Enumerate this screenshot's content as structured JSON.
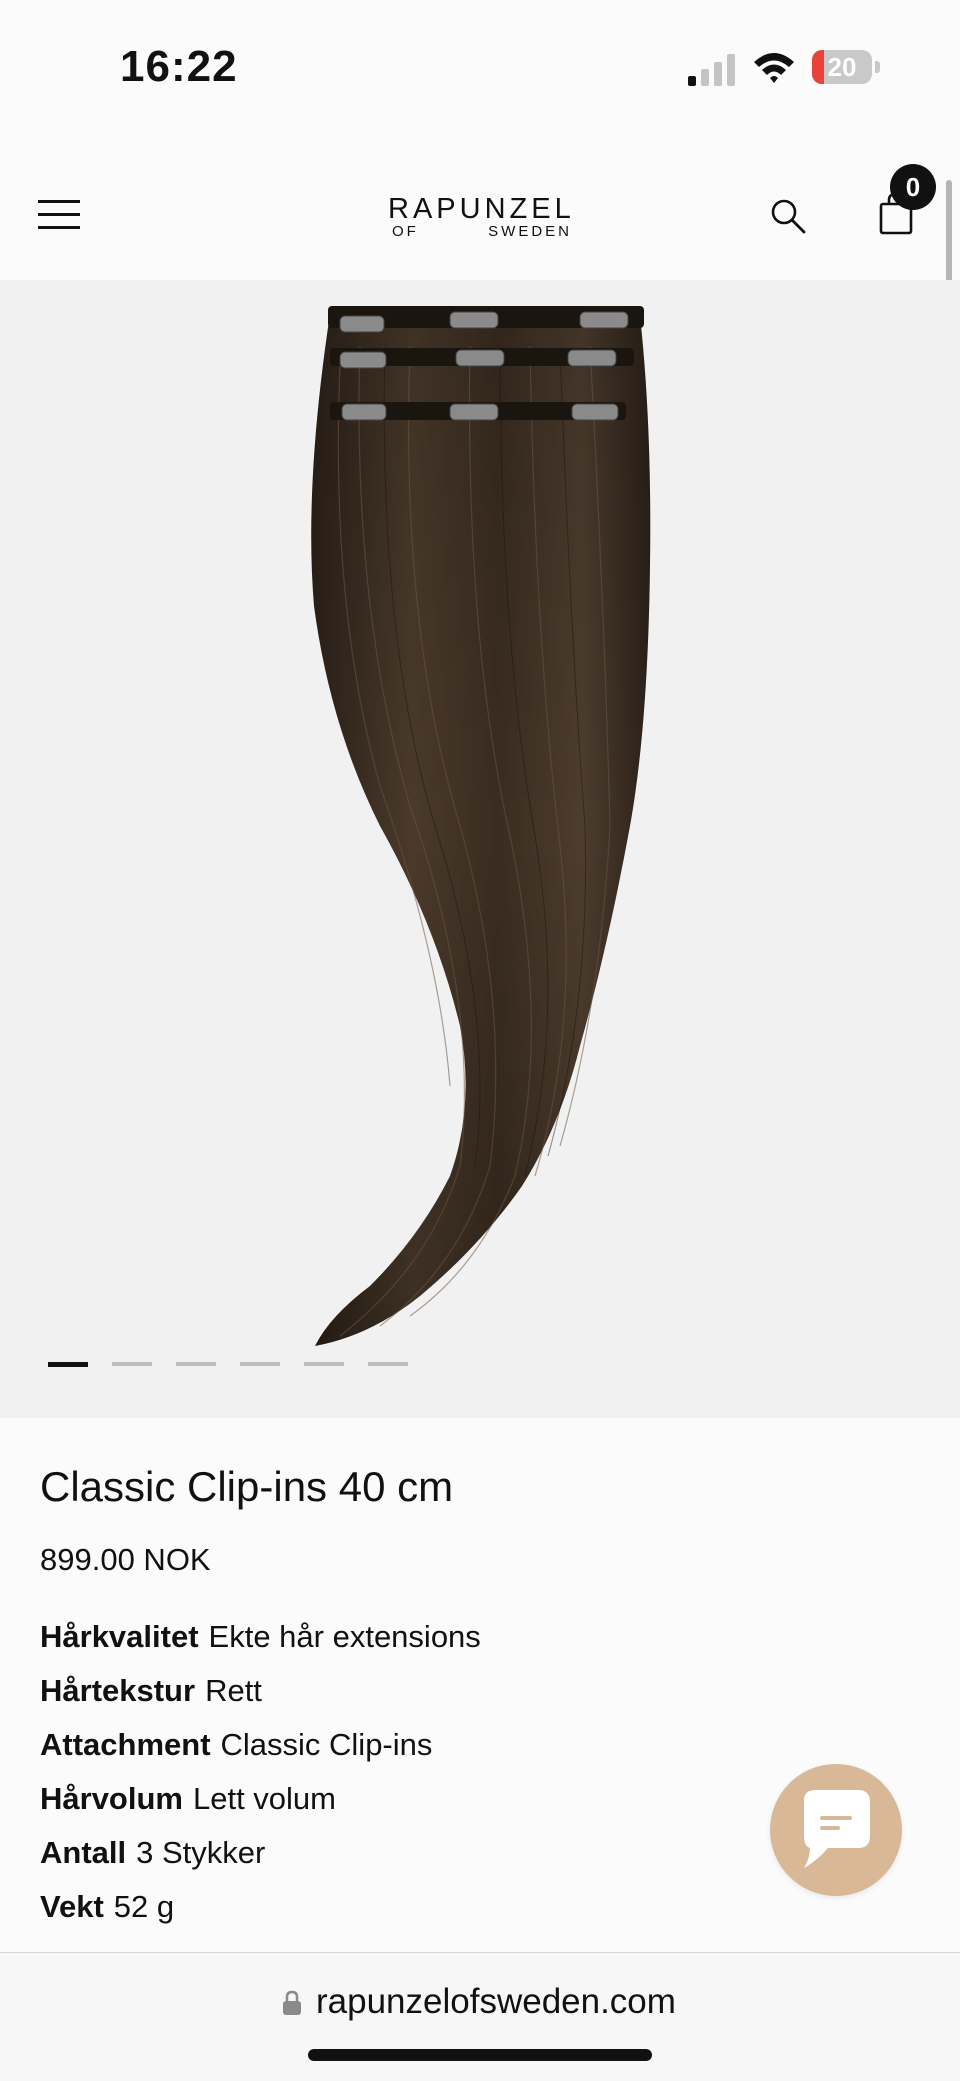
{
  "status_bar": {
    "time": "16:22",
    "battery_percent": "20",
    "battery_level": 0.2,
    "signal_bars_active": 1,
    "signal_bars_total": 4
  },
  "header": {
    "logo_main": "RAPUNZEL",
    "logo_sub_left": "OF",
    "logo_sub_right": "SWEDEN",
    "cart_count": "0",
    "icons": [
      "menu-icon",
      "search-icon",
      "shopping-bag-icon"
    ]
  },
  "gallery": {
    "image_count": 6,
    "active_index": 0
  },
  "product": {
    "title": "Classic Clip-ins 40 cm",
    "price": "899.00 NOK",
    "specs": [
      {
        "label": "Hårkvalitet",
        "value": "Ekte hår extensions"
      },
      {
        "label": "Hårtekstur",
        "value": "Rett"
      },
      {
        "label": "Attachment",
        "value": "Classic Clip-ins"
      },
      {
        "label": "Hårvolum",
        "value": "Lett volum"
      },
      {
        "label": "Antall",
        "value": "3 Stykker"
      },
      {
        "label": "Vekt",
        "value": "52 g"
      }
    ]
  },
  "chat": {
    "icon": "chat-bubble-icon",
    "color": "#d8b896"
  },
  "browser": {
    "url": "rapunzelofsweden.com",
    "icon": "lock-icon"
  },
  "colors": {
    "accent_chat": "#d8b896",
    "battery_low": "#e8433a",
    "hair": "#3a2c20"
  }
}
